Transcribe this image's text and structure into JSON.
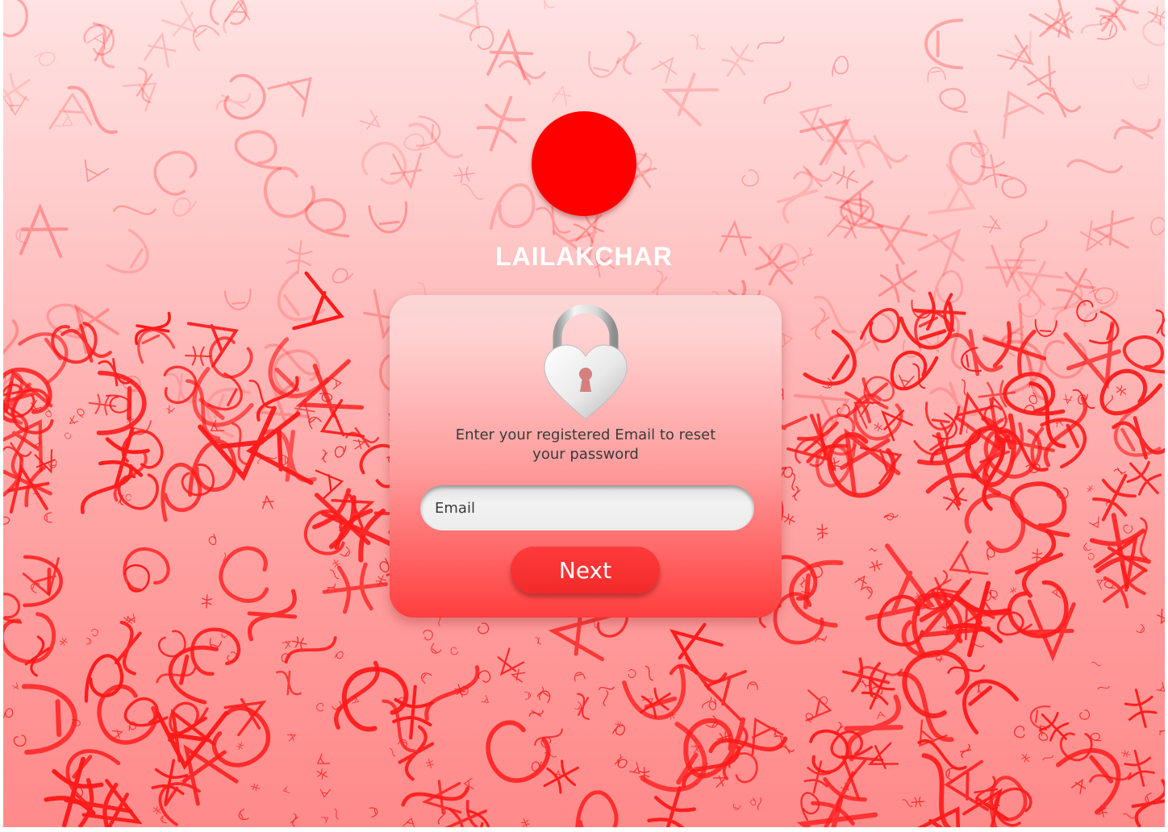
{
  "brand": {
    "name": "LAILAKCHAR",
    "logo_color": "#ff0000"
  },
  "reset_card": {
    "icon": "heart-padlock-icon",
    "instruction": "Enter your registered Email to reset your password",
    "email_placeholder": "Email",
    "next_label": "Next"
  },
  "colors": {
    "accent": "#ff2b2b",
    "background_top": "#ffe2e2",
    "background_bottom": "#ff8a8a",
    "glyph_red": "#ff1a1a"
  },
  "background": {
    "pattern": "red-script-glyphs"
  }
}
